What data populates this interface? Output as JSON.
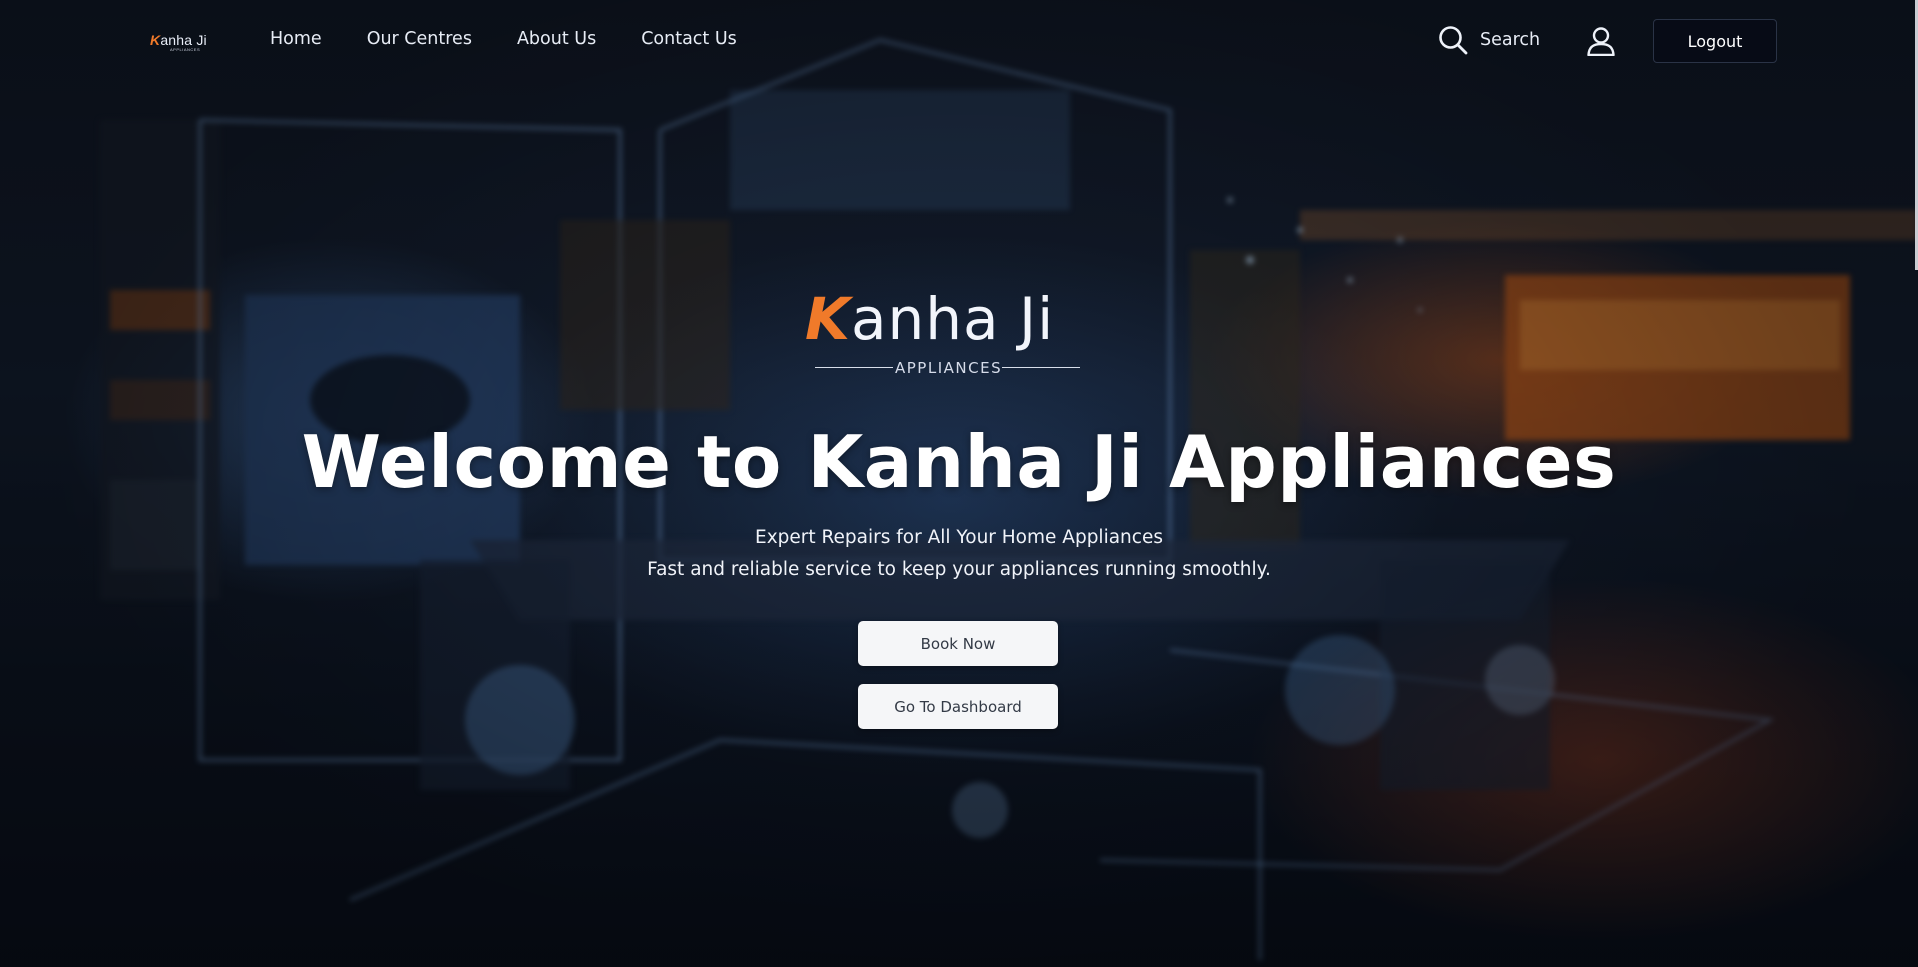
{
  "navbar": {
    "logo": {
      "k": "K",
      "rest": "anha Ji",
      "sub": "APPLIANCES"
    },
    "links": [
      "Home",
      "Our Centres",
      "About Us",
      "Contact Us"
    ],
    "search_label": "Search",
    "logout_label": "Logout"
  },
  "hero": {
    "brand": {
      "k": "K",
      "rest": "anha Ji",
      "sub": "APPLIANCES"
    },
    "title": "Welcome to Kanha Ji Appliances",
    "subtitle": "Expert Repairs for All Your Home Appliances",
    "tagline": "Fast and reliable service to keep your appliances running smoothly.",
    "book_label": "Book Now",
    "dashboard_label": "Go To Dashboard"
  },
  "colors": {
    "accent": "#f07a2a",
    "logout_bg": "#070b16",
    "button_bg": "#f5f6f8"
  },
  "icons": {
    "search": "search-icon",
    "user": "user-icon"
  }
}
